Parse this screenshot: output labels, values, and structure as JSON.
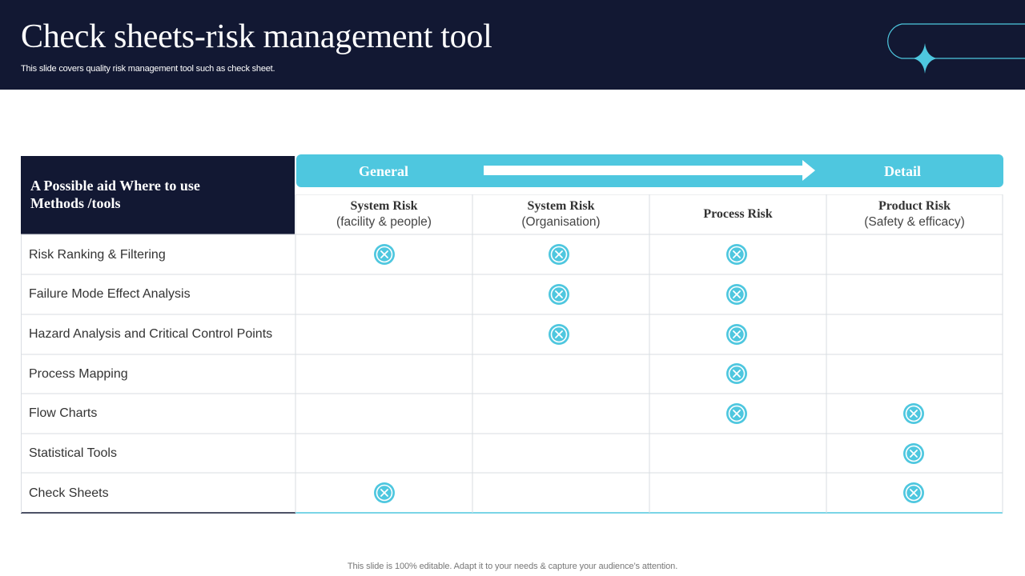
{
  "header": {
    "title": "Check sheets-risk management tool",
    "subtitle": "This slide covers quality risk management tool such as check sheet."
  },
  "banner": {
    "left_label": "General",
    "right_label": "Detail"
  },
  "table": {
    "corner_label_line1": "A Possible aid Where to  use",
    "corner_label_line2": "Methods /tools",
    "columns": [
      {
        "title": "System Risk",
        "subtitle": "(facility & people)"
      },
      {
        "title": "System Risk",
        "subtitle": "(Organisation)"
      },
      {
        "title": "Process Risk",
        "subtitle": ""
      },
      {
        "title": "Product Risk",
        "subtitle": "(Safety & efficacy)"
      }
    ],
    "rows": [
      {
        "label": "Risk Ranking & Filtering",
        "marks": [
          true,
          true,
          true,
          false
        ]
      },
      {
        "label": "Failure Mode Effect Analysis",
        "marks": [
          false,
          true,
          true,
          false
        ]
      },
      {
        "label": "Hazard Analysis and Critical Control Points",
        "marks": [
          false,
          true,
          true,
          false
        ]
      },
      {
        "label": "Process Mapping",
        "marks": [
          false,
          false,
          true,
          false
        ]
      },
      {
        "label": "Flow Charts",
        "marks": [
          false,
          false,
          true,
          true
        ]
      },
      {
        "label": "Statistical Tools",
        "marks": [
          false,
          false,
          false,
          true
        ]
      },
      {
        "label": "Check Sheets",
        "marks": [
          true,
          false,
          false,
          true
        ]
      }
    ],
    "mark_icon": "x-circle-icon"
  },
  "colors": {
    "header_bg": "#121833",
    "accent": "#4ec7df",
    "grid": "#d9dde2"
  },
  "footer": {
    "note": "This slide is 100% editable. Adapt it to your needs & capture your audience’s attention."
  }
}
